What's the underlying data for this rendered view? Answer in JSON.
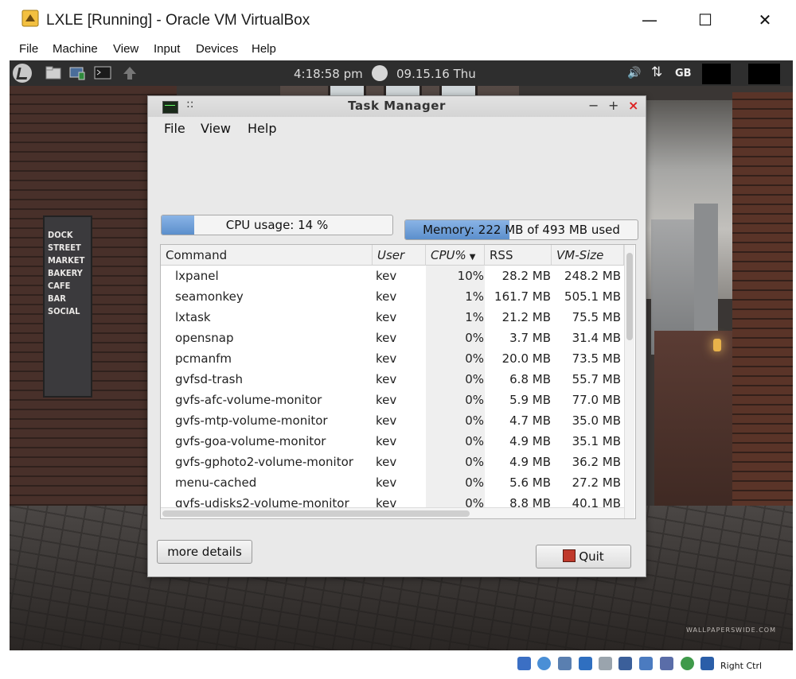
{
  "host": {
    "window_title": "LXLE [Running] - Oracle VM VirtualBox",
    "controls": {
      "minimize": "—",
      "maximize": "☐",
      "close": "✕"
    },
    "menu": [
      "File",
      "Machine",
      "View",
      "Input",
      "Devices",
      "Help"
    ],
    "status_host_key": "Right Ctrl"
  },
  "panel": {
    "time": "4:18:58 pm",
    "date": "09.15.16 Thu",
    "keyboard_layout": "GB",
    "volume_glyph": "🔊",
    "network_glyph": "⇅"
  },
  "wallpaper": {
    "sign_text": "DOCK STREET MARKET BAKERY CAFE BAR SOCIAL",
    "watermark": "WALLPAPERSWIDE.COM"
  },
  "task_manager": {
    "title": "Task Manager",
    "title_buttons": {
      "grip": "::",
      "minimize": "−",
      "maximize": "+",
      "close": "×"
    },
    "menu": [
      "File",
      "View",
      "Help"
    ],
    "cpu_label": "CPU usage: 14 %",
    "cpu_fraction": 0.14,
    "memory_label": "Memory: 222 MB of 493 MB used",
    "memory_fraction": 0.45,
    "columns": [
      "Command",
      "User",
      "CPU%",
      "RSS",
      "VM-Size"
    ],
    "sort_indicator": "▼",
    "rows": [
      {
        "command": "lxpanel",
        "user": "kev",
        "cpu": "10%",
        "rss": "28.2 MB",
        "vm": "248.2 MB"
      },
      {
        "command": "seamonkey",
        "user": "kev",
        "cpu": "1%",
        "rss": "161.7 MB",
        "vm": "505.1 MB"
      },
      {
        "command": "lxtask",
        "user": "kev",
        "cpu": "1%",
        "rss": "21.2 MB",
        "vm": "75.5 MB"
      },
      {
        "command": "opensnap",
        "user": "kev",
        "cpu": "0%",
        "rss": "3.7 MB",
        "vm": "31.4 MB"
      },
      {
        "command": "pcmanfm",
        "user": "kev",
        "cpu": "0%",
        "rss": "20.0 MB",
        "vm": "73.5 MB"
      },
      {
        "command": "gvfsd-trash",
        "user": "kev",
        "cpu": "0%",
        "rss": "6.8 MB",
        "vm": "55.7 MB"
      },
      {
        "command": "gvfs-afc-volume-monitor",
        "user": "kev",
        "cpu": "0%",
        "rss": "5.9 MB",
        "vm": "77.0 MB"
      },
      {
        "command": "gvfs-mtp-volume-monitor",
        "user": "kev",
        "cpu": "0%",
        "rss": "4.7 MB",
        "vm": "35.0 MB"
      },
      {
        "command": "gvfs-goa-volume-monitor",
        "user": "kev",
        "cpu": "0%",
        "rss": "4.9 MB",
        "vm": "35.1 MB"
      },
      {
        "command": "gvfs-gphoto2-volume-monitor",
        "user": "kev",
        "cpu": "0%",
        "rss": "4.9 MB",
        "vm": "36.2 MB"
      },
      {
        "command": "menu-cached",
        "user": "kev",
        "cpu": "0%",
        "rss": "5.6 MB",
        "vm": "27.2 MB"
      },
      {
        "command": "gvfs-udisks2-volume-monitor",
        "user": "kev",
        "cpu": "0%",
        "rss": "8.8 MB",
        "vm": "40.1 MB"
      }
    ],
    "more_details_label": "more details",
    "quit_label": "Quit"
  }
}
